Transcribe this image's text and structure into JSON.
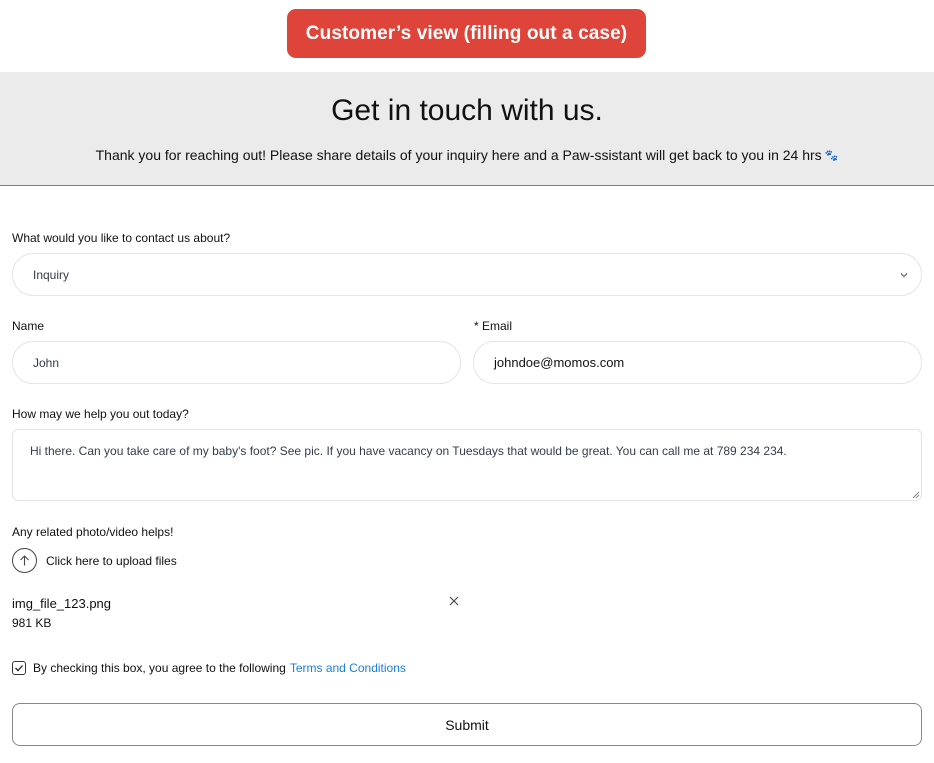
{
  "banner": {
    "label": "Customer’s view (filling out a case)",
    "color": "#de4439"
  },
  "hero": {
    "title": "Get in touch with us.",
    "subtitle": "Thank you for reaching out! Please share details of your inquiry here and a Paw-ssistant will get back to you in 24 hrs",
    "icon": "paw-prints-icon"
  },
  "form": {
    "topic": {
      "label": "What would you like to contact us about?",
      "value": "Inquiry"
    },
    "name": {
      "label": "Name",
      "value": "John"
    },
    "email": {
      "label": "* Email",
      "value": "johndoe@momos.com"
    },
    "message": {
      "label": "How may we help you out today?",
      "value": "Hi there. Can you take care of my baby's foot? See pic. If you have vacancy on Tuesdays that would be great. You can call me at 789 234 234."
    },
    "upload": {
      "label": "Any related photo/video helps!",
      "button": "Click here to upload files"
    },
    "file": {
      "name": "img_file_123.png",
      "size": "981 KB"
    },
    "terms": {
      "checked": true,
      "text": "By checking this box, you agree to the following",
      "link": "Terms and Conditions",
      "link_color": "#1a7fe0"
    },
    "submit": "Submit"
  }
}
